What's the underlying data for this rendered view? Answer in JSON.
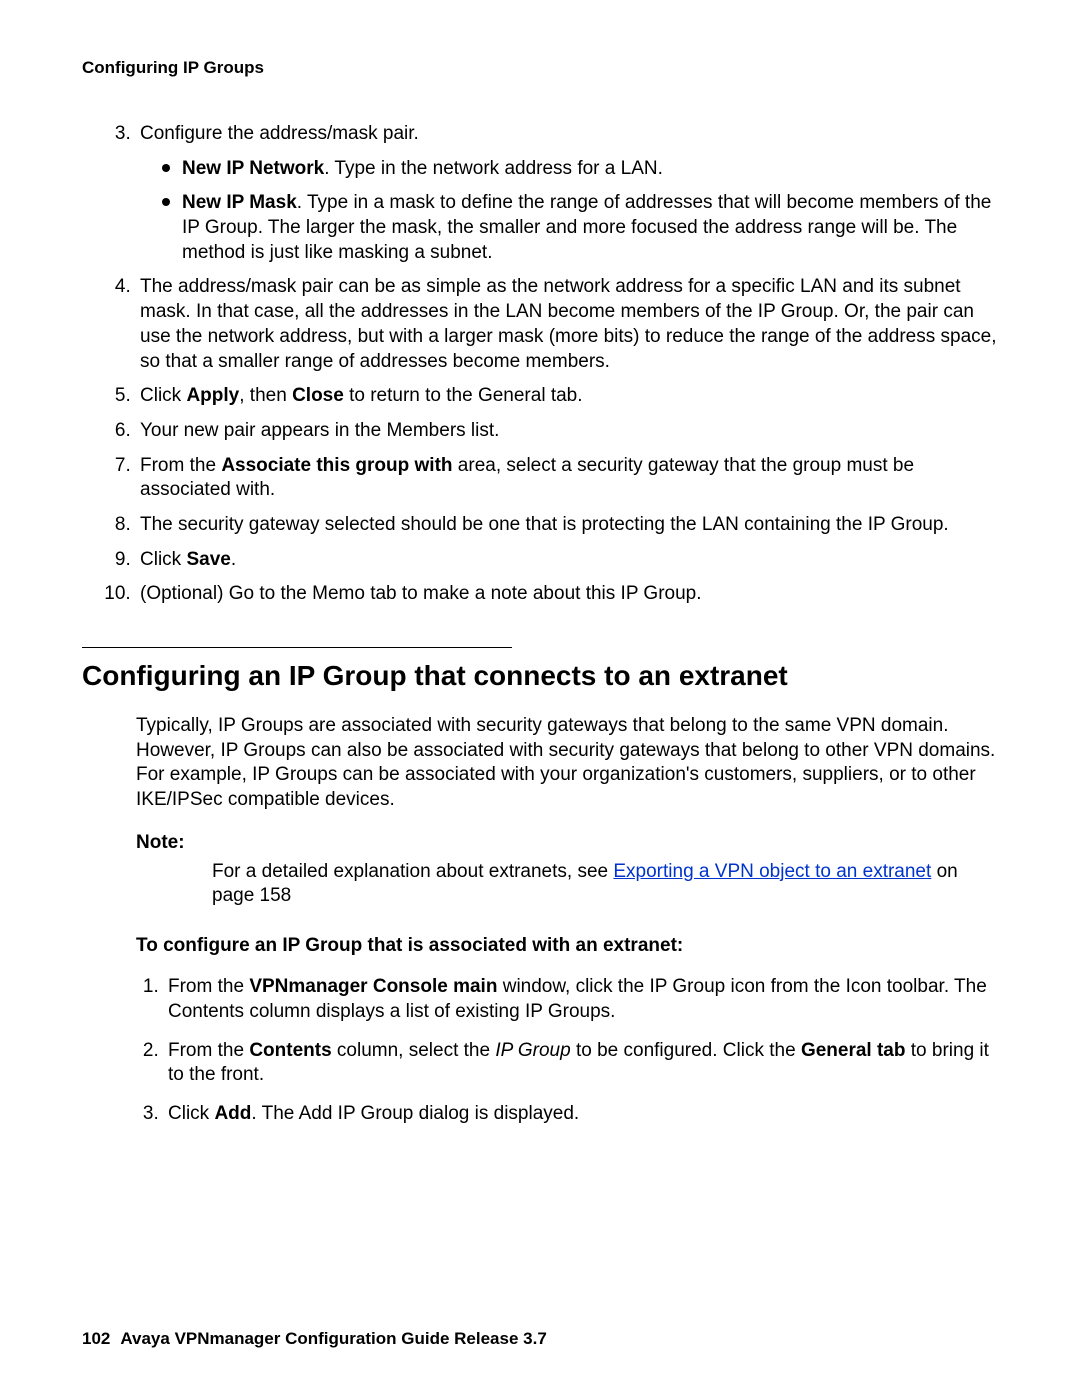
{
  "header": "Configuring IP Groups",
  "steps1": {
    "start": 3,
    "item3": {
      "lead": "Configure the address/mask pair.",
      "b1_bold": "New IP Network",
      "b1_rest": ". Type in the network address for a LAN.",
      "b2_bold": "New IP Mask",
      "b2_rest": ". Type in a mask to define the range of addresses that will become members of the IP Group. The larger the mask, the smaller and more focused the address range will be. The method is just like masking a subnet."
    },
    "item4": "The address/mask pair can be as simple as the network address for a specific LAN and its subnet mask. In that case, all the addresses in the LAN become members of the IP Group. Or, the pair can use the network address, but with a larger mask (more bits) to reduce the range of the address space, so that a smaller range of addresses become members.",
    "item5_pre": "Click ",
    "item5_b1": "Apply",
    "item5_mid": ", then ",
    "item5_b2": "Close",
    "item5_post": " to return to the General tab.",
    "item6": "Your new pair appears in the Members list.",
    "item7_pre": "From the ",
    "item7_b": "Associate this group with",
    "item7_post": " area, select a security gateway that the group must be associated with.",
    "item8": "The security gateway selected should be one that is protecting the LAN containing the IP Group.",
    "item9_pre": "Click ",
    "item9_b": "Save",
    "item9_post": ".",
    "item10": "(Optional) Go to the Memo tab to make a note about this IP Group."
  },
  "section_heading": "Configuring an IP Group that connects to an extranet",
  "intro": "Typically, IP Groups are associated with security gateways that belong to the same VPN domain. However, IP Groups can also be associated with security gateways that belong to other VPN domains. For example, IP Groups can be associated with your organization's customers, suppliers, or to other IKE/IPSec compatible devices.",
  "note_label": "Note:",
  "note_pre": "For a detailed explanation about extranets, see ",
  "note_link": "Exporting a VPN object to an extranet",
  "note_post": " on page 158",
  "task_heading": "To configure an IP Group that is associated with an extranet:",
  "steps2": {
    "item1_pre": "From the ",
    "item1_b": "VPNmanager Console main",
    "item1_post": " window, click the IP Group icon from the Icon toolbar. The Contents column displays a list of existing IP Groups.",
    "item2_pre": "From the ",
    "item2_b1": "Contents",
    "item2_mid1": " column, select the ",
    "item2_i": "IP Group",
    "item2_mid2": " to be configured. Click the ",
    "item2_b2": "General tab",
    "item2_post": " to bring it to the front.",
    "item3_pre": "Click ",
    "item3_b": "Add",
    "item3_post": ". The Add IP Group dialog is displayed."
  },
  "footer": {
    "page": "102",
    "title": "Avaya VPNmanager Configuration Guide Release 3.7"
  }
}
